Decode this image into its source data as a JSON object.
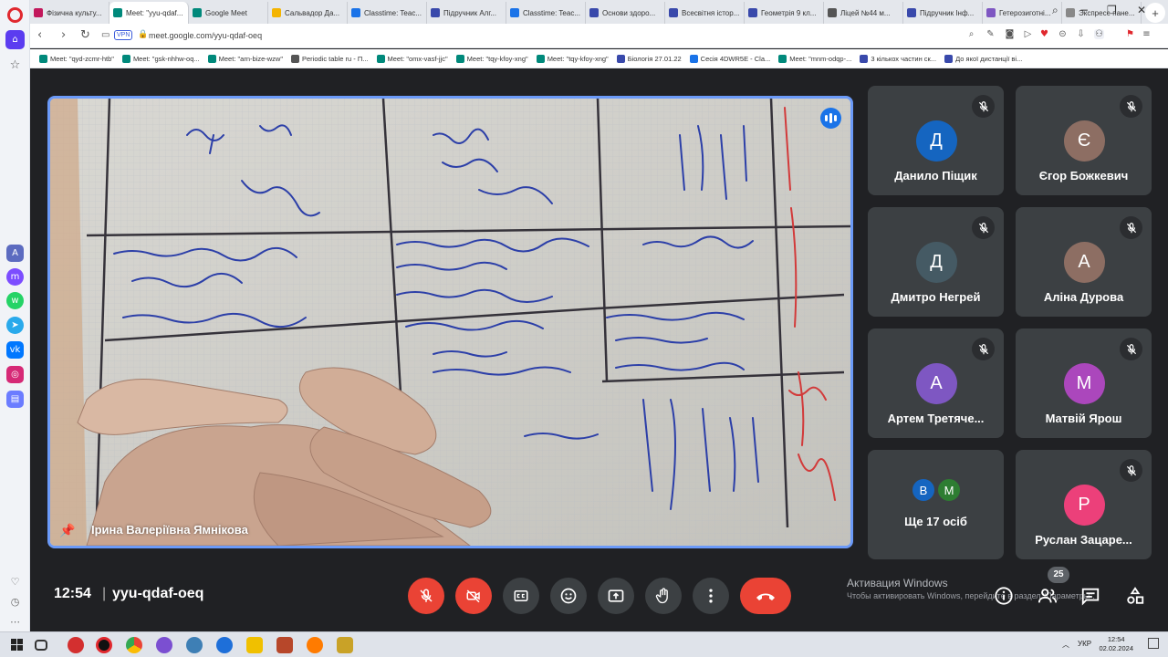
{
  "browser": {
    "tabs": [
      {
        "label": "Фізична культу...",
        "color": "#c2185b"
      },
      {
        "label": "Meet: \"yyu-qdaf...",
        "color": "#00897b",
        "active": true
      },
      {
        "label": "Google Meet",
        "color": "#00897b"
      },
      {
        "label": "Сальвадор Да...",
        "color": "#f4b400"
      },
      {
        "label": "Classtime: Teac...",
        "color": "#1a73e8"
      },
      {
        "label": "Підручник Алг...",
        "color": "#3949ab"
      },
      {
        "label": "Classtime: Teac...",
        "color": "#1a73e8"
      },
      {
        "label": "Основи здоро...",
        "color": "#3949ab"
      },
      {
        "label": "Всесвітня істор...",
        "color": "#3949ab"
      },
      {
        "label": "Геометрія 9 кл...",
        "color": "#3949ab"
      },
      {
        "label": "Ліцей №44 м...",
        "color": "#555555"
      },
      {
        "label": "Підручник Інф...",
        "color": "#3949ab"
      },
      {
        "label": "Гетерозиготні...",
        "color": "#7e57c2"
      },
      {
        "label": "Экспресс-пане...",
        "color": "#888888"
      }
    ],
    "new_tab": "+",
    "url": "meet.google.com/yyu-qdaf-oeq",
    "vpn": "VPN",
    "bookmarks": [
      {
        "label": "Meet: \"qyd-zcmr-htb\"",
        "color": "#00897b"
      },
      {
        "label": "Meet: \"gsk-nhhw-oq...",
        "color": "#00897b"
      },
      {
        "label": "Meet: \"arn-bize-wzw\"",
        "color": "#00897b"
      },
      {
        "label": "Periodic table ru - П...",
        "color": "#555555"
      },
      {
        "label": "Meet: \"omx-vasf-jjc\"",
        "color": "#00897b"
      },
      {
        "label": "Meet: \"tqy-kfoy-xng\"",
        "color": "#00897b"
      },
      {
        "label": "Meet: \"tqy-kfoy-xng\"",
        "color": "#00897b"
      },
      {
        "label": "Біологія 27.01.22",
        "color": "#3949ab"
      },
      {
        "label": "Сесія 4DWR5E - Cla...",
        "color": "#1a73e8"
      },
      {
        "label": "Meet: \"mnm-odqp-...",
        "color": "#00897b"
      },
      {
        "label": "3 кількох частин ск...",
        "color": "#3949ab"
      },
      {
        "label": "До якої дистанції ві...",
        "color": "#3949ab"
      }
    ]
  },
  "meet": {
    "presenter_name": "Ірина Валеріївна Ямнікова",
    "participants": [
      {
        "name": "Данило Піщик",
        "initial": "Д",
        "color": "#1565c0"
      },
      {
        "name": "Єгор Божкевич",
        "initial": "Є",
        "color": "#8d6e63"
      },
      {
        "name": "Дмитро Негрей",
        "initial": "Д",
        "color": "#455a64"
      },
      {
        "name": "Аліна Дурова",
        "initial": "А",
        "color": "#8d6e63"
      },
      {
        "name": "Артем Третяче...",
        "initial": "А",
        "color": "#7e57c2"
      },
      {
        "name": "Матвій Ярош",
        "initial": "М",
        "color": "#ab47bc"
      },
      {
        "name": "Руслан Зацаре...",
        "initial": "Р",
        "color": "#ec407a"
      }
    ],
    "more": {
      "label": "Ще 17 осіб",
      "avatars": [
        {
          "initial": "В",
          "color": "#1565c0"
        },
        {
          "initial": "М",
          "color": "#2e7d32"
        }
      ]
    },
    "time": "12:54",
    "separator": "|",
    "meeting_code": "yyu-qdaf-oeq",
    "participant_count": "25",
    "watermark": {
      "title": "Активация Windows",
      "subtitle": "Чтобы активировать Windows, перейдите в раздел \"Параметры\"."
    }
  },
  "taskbar": {
    "language": "УКР",
    "time": "12:54",
    "date": "02.02.2024"
  }
}
